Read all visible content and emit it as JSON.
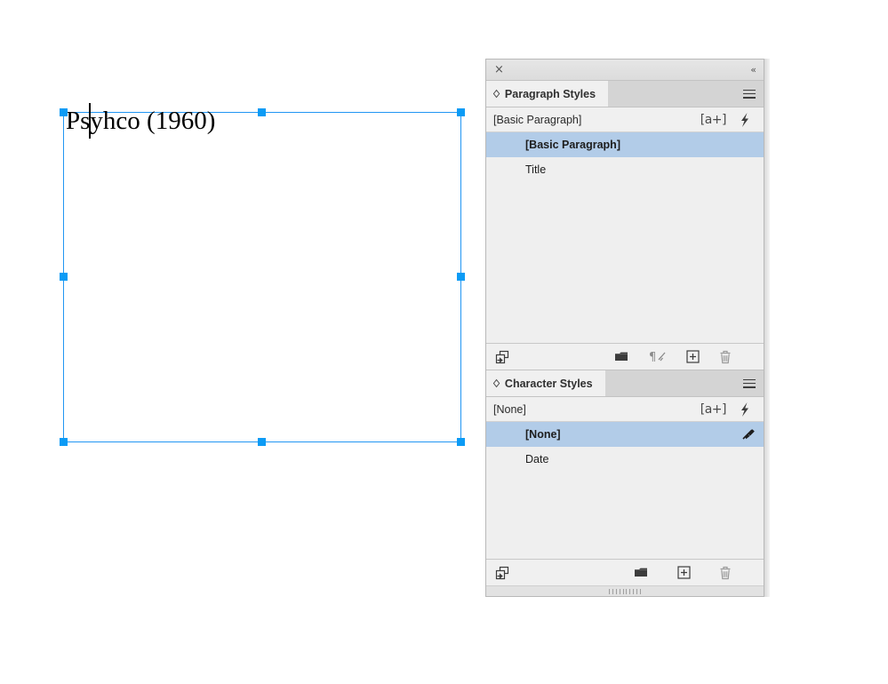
{
  "document": {
    "text_frame": {
      "content": "Psyhco (1960)",
      "caret_visible": true
    }
  },
  "dock": {
    "close_icon": "×",
    "collapse_icon": "«"
  },
  "paragraph_styles_panel": {
    "tab_label": "Paragraph Styles",
    "tab_collapse_glyph": "◇",
    "menu_icon": "panel-menu-icon",
    "current_style": "[Basic Paragraph]",
    "current_row_icons": {
      "a_plus": "[a+]",
      "quick_apply": "lightning-bolt-icon"
    },
    "styles": [
      {
        "name": "[Basic Paragraph]",
        "selected": true
      },
      {
        "name": "Title",
        "selected": false
      }
    ],
    "footer_buttons": [
      {
        "name": "load-paragraph-styles-button",
        "icon": "load-styles-icon"
      },
      {
        "name": "new-style-group-button",
        "icon": "folder-icon"
      },
      {
        "name": "clear-overrides-button",
        "icon": "clear-overrides-icon"
      },
      {
        "name": "create-new-style-button",
        "icon": "plus-box-icon"
      },
      {
        "name": "delete-style-button",
        "icon": "trash-icon"
      }
    ]
  },
  "character_styles_panel": {
    "tab_label": "Character Styles",
    "tab_collapse_glyph": "◇",
    "menu_icon": "panel-menu-icon",
    "current_style": "[None]",
    "current_row_icons": {
      "a_plus": "[a+]",
      "quick_apply": "lightning-bolt-icon"
    },
    "styles": [
      {
        "name": "[None]",
        "selected": true,
        "trailing_icon": "clear-overrides-icon"
      },
      {
        "name": "Date",
        "selected": false,
        "trailing_icon": ""
      }
    ],
    "footer_buttons": [
      {
        "name": "load-character-styles-button",
        "icon": "load-styles-icon"
      },
      {
        "name": "new-style-group-button",
        "icon": "folder-icon"
      },
      {
        "name": "create-new-style-button",
        "icon": "plus-box-icon"
      },
      {
        "name": "delete-style-button",
        "icon": "trash-icon"
      }
    ]
  },
  "colors": {
    "selection_blue": "#0c9bf5",
    "row_highlight": "#b2cce8",
    "panel_bg": "#f0f0f0",
    "list_bg": "#efefef",
    "tabstrip_bg": "#d4d4d4"
  }
}
